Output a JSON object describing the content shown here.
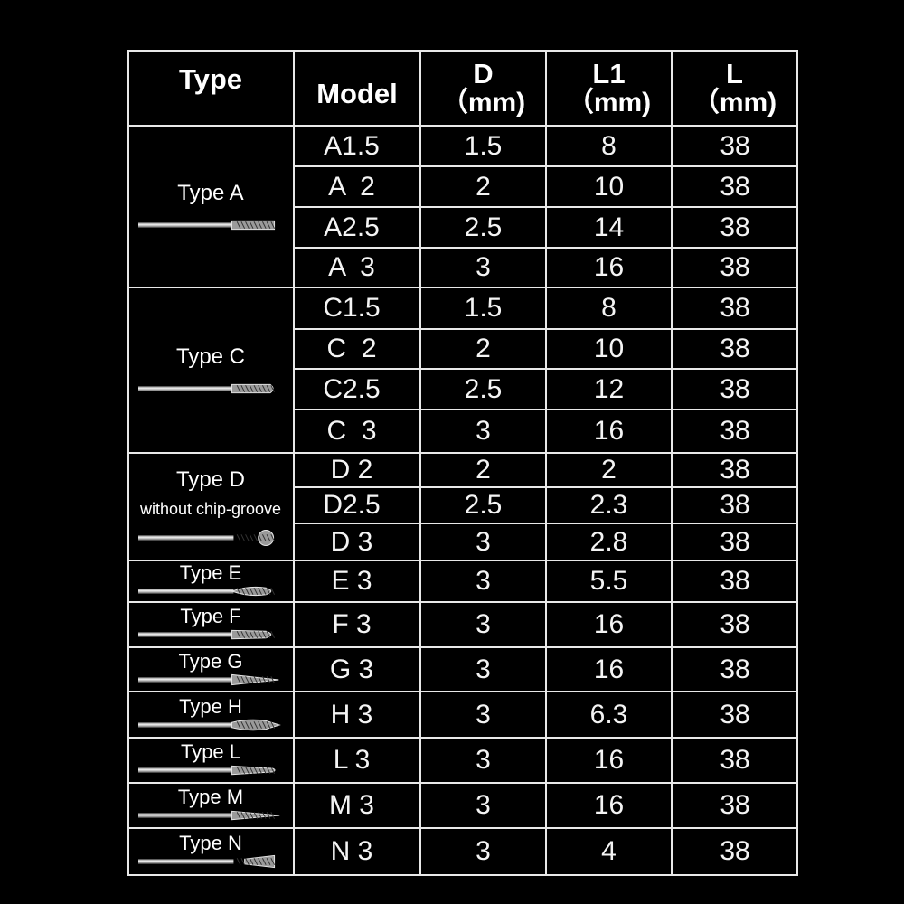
{
  "headers": {
    "type": "Type",
    "model": "Model",
    "d": "D",
    "d_unit": "（mm)",
    "l1": "L1",
    "l1_unit": "（mm)",
    "l": "L",
    "l_unit": "（mm)"
  },
  "groups": [
    {
      "label": "Type A",
      "sublabel": "",
      "icon": "cylinder-burr-icon"
    },
    {
      "label": "Type C",
      "sublabel": "",
      "icon": "round-nose-cylinder-burr-icon"
    },
    {
      "label": "Type D",
      "sublabel": "without chip-groove",
      "icon": "ball-burr-icon"
    },
    {
      "label": "Type E",
      "sublabel": "",
      "icon": "oval-burr-icon"
    },
    {
      "label": "Type F",
      "sublabel": "",
      "icon": "tree-round-burr-icon"
    },
    {
      "label": "Type G",
      "sublabel": "",
      "icon": "tree-pointed-burr-icon"
    },
    {
      "label": "Type H",
      "sublabel": "",
      "icon": "flame-burr-icon"
    },
    {
      "label": "Type L",
      "sublabel": "",
      "icon": "cone-round-burr-icon"
    },
    {
      "label": "Type M",
      "sublabel": "",
      "icon": "cone-pointed-burr-icon"
    },
    {
      "label": "Type N",
      "sublabel": "",
      "icon": "inverted-cone-burr-icon"
    }
  ],
  "rows": [
    {
      "model": "A1.5",
      "d": "1.5",
      "l1": "8",
      "l": "38"
    },
    {
      "model": "A  2",
      "d": "2",
      "l1": "10",
      "l": "38"
    },
    {
      "model": "A2.5",
      "d": "2.5",
      "l1": "14",
      "l": "38"
    },
    {
      "model": "A  3",
      "d": "3",
      "l1": "16",
      "l": "38"
    },
    {
      "model": "C1.5",
      "d": "1.5",
      "l1": "8",
      "l": "38"
    },
    {
      "model": "C  2",
      "d": "2",
      "l1": "10",
      "l": "38"
    },
    {
      "model": "C2.5",
      "d": "2.5",
      "l1": "12",
      "l": "38"
    },
    {
      "model": "C  3",
      "d": "3",
      "l1": "16",
      "l": "38"
    },
    {
      "model": "D 2",
      "d": "2",
      "l1": "2",
      "l": "38"
    },
    {
      "model": "D2.5",
      "d": "2.5",
      "l1": "2.3",
      "l": "38"
    },
    {
      "model": "D 3",
      "d": "3",
      "l1": "2.8",
      "l": "38"
    },
    {
      "model": "E 3",
      "d": "3",
      "l1": "5.5",
      "l": "38"
    },
    {
      "model": "F 3",
      "d": "3",
      "l1": "16",
      "l": "38"
    },
    {
      "model": "G 3",
      "d": "3",
      "l1": "16",
      "l": "38"
    },
    {
      "model": "H 3",
      "d": "3",
      "l1": "6.3",
      "l": "38"
    },
    {
      "model": "L 3",
      "d": "3",
      "l1": "16",
      "l": "38"
    },
    {
      "model": "M 3",
      "d": "3",
      "l1": "16",
      "l": "38"
    },
    {
      "model": "N 3",
      "d": "3",
      "l1": "4",
      "l": "38"
    }
  ]
}
